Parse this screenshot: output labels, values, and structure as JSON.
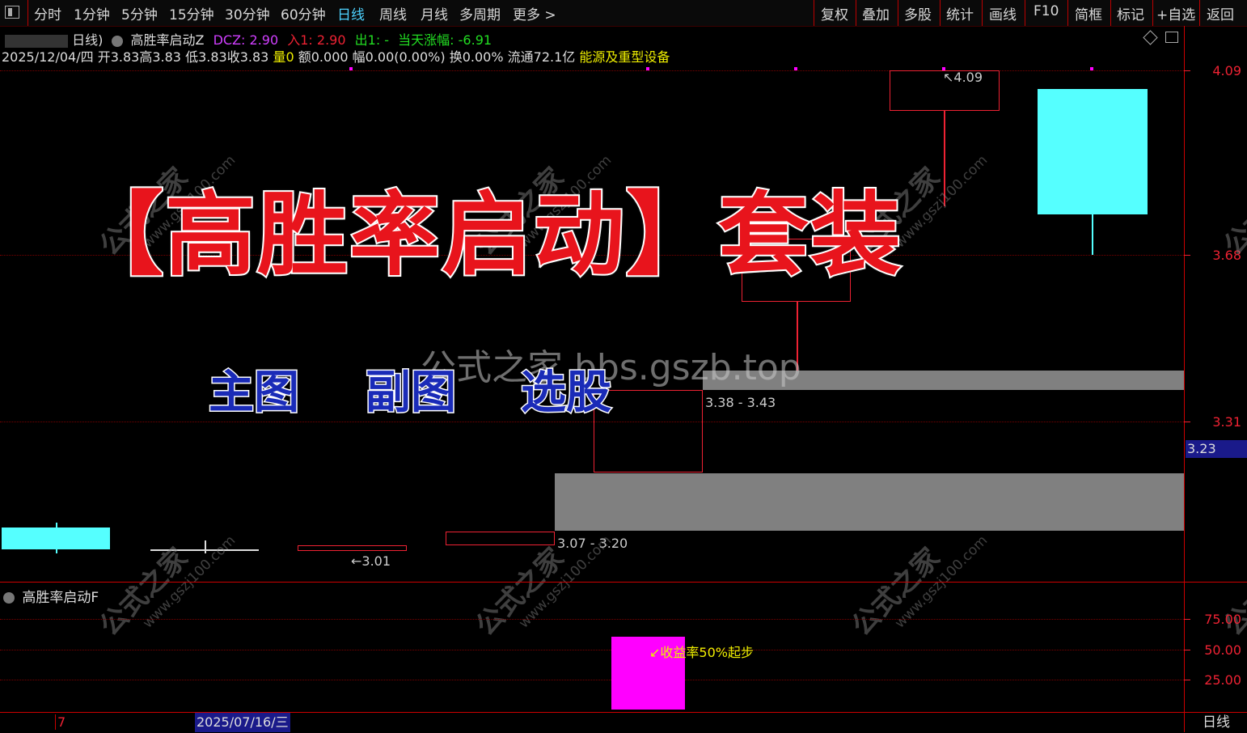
{
  "toolbar": {
    "periods": [
      "分时",
      "1分钟",
      "5分钟",
      "15分钟",
      "30分钟",
      "60分钟",
      "日线",
      "周线",
      "月线",
      "多周期",
      "更多 >"
    ],
    "active": "日线",
    "tools": [
      "复权",
      "叠加",
      "多股",
      "统计",
      "画线",
      "F10",
      "简框",
      "标记",
      "+自选",
      "返回"
    ]
  },
  "header": {
    "stock_suffix": "日线)",
    "indicator_name": "高胜率启动Z",
    "dcz": "DCZ: 2.90",
    "in1": "入1: 2.90",
    "out1": "出1: -",
    "change": "当天涨幅: -6.91"
  },
  "quote": {
    "date": "2025/12/04/四",
    "open": "开3.83",
    "high": "高3.83",
    "low": "低3.83",
    "close": "收3.83",
    "vol": "量0",
    "amount": "额0.000",
    "pct": "幅0.00(0.00%)",
    "turnover": "换0.00%",
    "float": "流通72.1亿",
    "sector": "能源及重型设备"
  },
  "price_axis": {
    "labels": [
      "4.09",
      "3.68",
      "3.31"
    ],
    "current": "3.23"
  },
  "chart": {
    "label_409": "4.09",
    "label_301": "3.01",
    "zone_high": "3.38 - 3.43",
    "zone_low": "3.07 - 3.20"
  },
  "overlay": {
    "title": "【高胜率启动】套装",
    "sub1": "主图",
    "sub2": "副图",
    "sub3": "选股",
    "site": "公式之家 bbs.gszb.top",
    "wm_cn": "公式之家",
    "wm_url": "www.gszj100.com"
  },
  "sub_panel": {
    "name": "高胜率启动F",
    "annotation": "↙收益率50%起步",
    "axis": [
      "75.00",
      "50.00",
      "25.00"
    ]
  },
  "footer": {
    "left": "7",
    "date": "2025/07/16/三",
    "period": "日线"
  },
  "colors": {
    "up": "#e8141c",
    "down": "#55ffff",
    "zone": "#808080",
    "signal": "#ff00ff"
  }
}
